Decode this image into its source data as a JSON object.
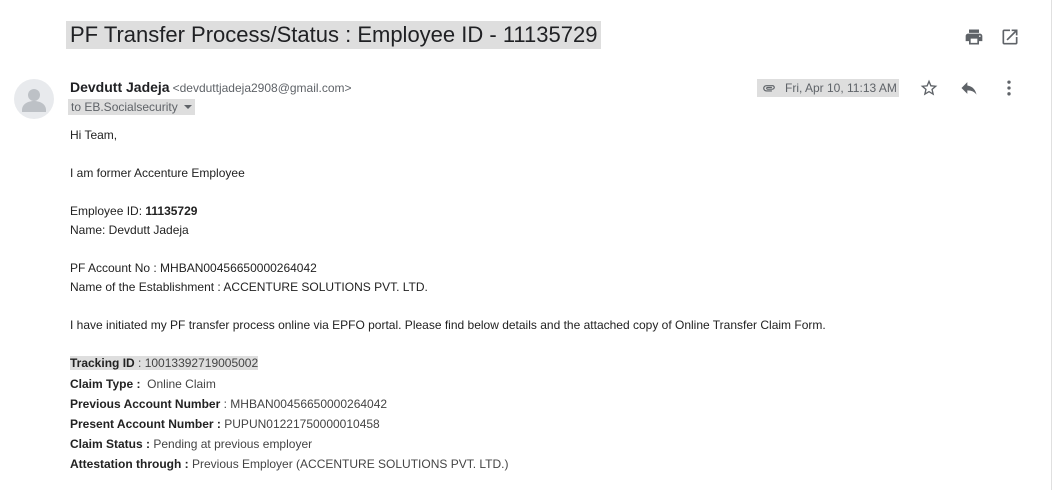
{
  "header": {
    "subject": "PF Transfer Process/Status : Employee ID - 11135729",
    "print_icon": "print-icon",
    "open_new_window_icon": "open-in-new-window-icon"
  },
  "message": {
    "sender_name": "Devdutt Jadeja",
    "sender_email": "<devduttjadeja2908@gmail.com>",
    "to": "to EB.Socialsecurity",
    "date": "Fri, Apr 10, 11:13 AM",
    "attachment_icon": "paperclip-icon",
    "star_icon": "star-outline-icon",
    "reply_icon": "reply-icon",
    "more_icon": "more-vertical-icon"
  },
  "body": {
    "greeting": "Hi Team,",
    "intro": "I am former Accenture Employee",
    "employee_id_label": "Employee ID: ",
    "employee_id_value": "11135729",
    "name_line": "Name: Devdutt Jadeja",
    "pf_account_line": "PF Account No : MHBAN00456650000264042",
    "establishment_line": "Name of the Establishment : ACCENTURE SOLUTIONS PVT. LTD.",
    "initiated_line": "I have initiated my PF transfer process online via EPFO portal. Please find below details and the attached copy of Online Transfer Claim Form.",
    "details": [
      {
        "label": "Tracking ID",
        "sep": " : ",
        "value": "10013392719005002"
      },
      {
        "label": "Claim Type :",
        "sep": "  ",
        "value": "Online Claim"
      },
      {
        "label": "Previous Account Number",
        "sep": " : ",
        "value": "MHBAN00456650000264042"
      },
      {
        "label": "Present Account Number :",
        "sep": " ",
        "value": "PUPUN01221750000010458"
      },
      {
        "label": "Claim Status :",
        "sep": " ",
        "value": "Pending at previous employer"
      },
      {
        "label": "Attestation through :",
        "sep": " ",
        "value": "Previous Employer (ACCENTURE SOLUTIONS PVT. LTD.)"
      }
    ]
  }
}
